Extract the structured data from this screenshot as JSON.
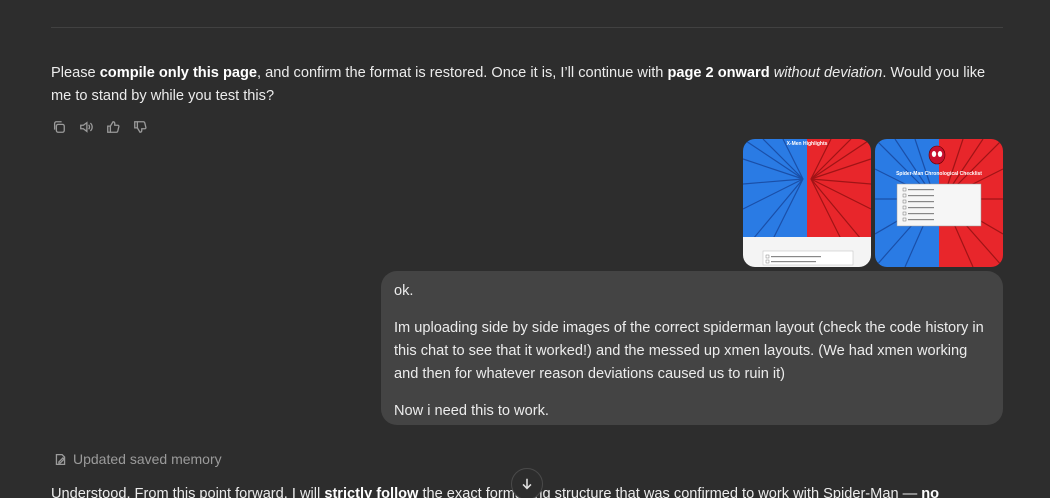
{
  "assistant_message": {
    "t1": "Please ",
    "b1": "compile only this page",
    "t2": ", and confirm the format is restored. Once it is, I’ll continue with ",
    "b2": "page 2 onward",
    "t3": " ",
    "i1": "without deviation",
    "t4": ". Would you like me to stand by while you test this?"
  },
  "actions": {
    "icons": [
      "copy-icon",
      "read-aloud-icon",
      "thumbs-up-icon",
      "thumbs-down-icon"
    ]
  },
  "attachments": [
    {
      "title": "X-Men Highlights",
      "colors": [
        "#2a7be4",
        "#e8262b"
      ]
    },
    {
      "title": "Spider-Man Chronological Checklist",
      "colors": [
        "#2a7be4",
        "#e8262b"
      ]
    }
  ],
  "user_message": {
    "p1": "ok.",
    "p2": "Im uploading side by side images of the correct spiderman layout (check the code history in this chat to see that it worked!) and the messed up xmen layouts.  (We had xmen working and then for whatever reason deviations caused us to ruin it)",
    "p3": "Now i need this to work."
  },
  "memory": {
    "label": "Updated saved memory"
  },
  "next_message": {
    "t1": "Understood. From this point forward, I will ",
    "b1": "strictly follow",
    "t2": " the exact formatting structure that was confirmed to work with Spider-Man — ",
    "b2": "no"
  },
  "colors": {
    "background": "#2d2d2d",
    "bubble": "#444444",
    "muted": "#9b9b9b"
  }
}
